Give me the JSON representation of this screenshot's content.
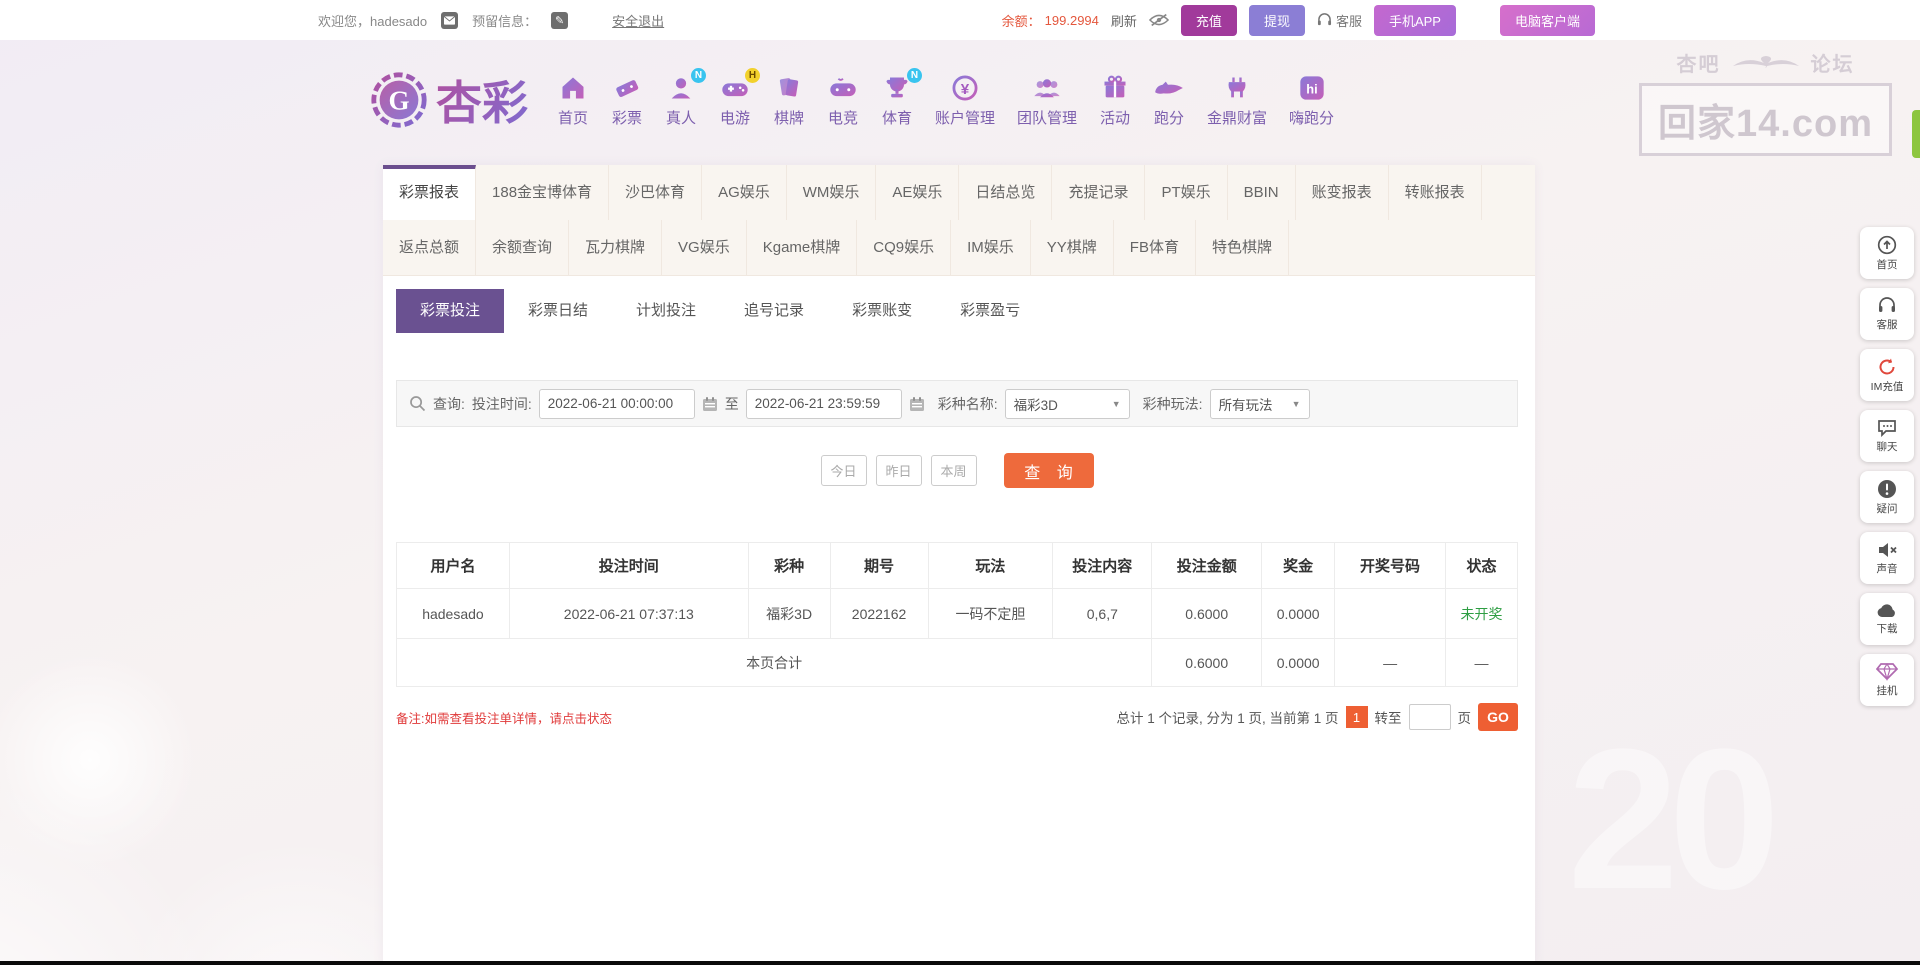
{
  "topbar": {
    "welcome": "欢迎您，hadesado",
    "reserved_label": "预留信息：",
    "logout": "安全退出",
    "balance_label": "余额：",
    "balance_value": "199.2994",
    "refresh": "刷新",
    "recharge": "充值",
    "withdraw": "提现",
    "service": "客服",
    "mobile_app": "手机APP",
    "pc_client": "电脑客户端"
  },
  "brand": {
    "name": "杏彩"
  },
  "nav": {
    "items": [
      {
        "label": "首页",
        "icon": "home-icon",
        "badge": ""
      },
      {
        "label": "彩票",
        "icon": "lottery-ticket-icon",
        "badge": ""
      },
      {
        "label": "真人",
        "icon": "live-dealer-icon",
        "badge": "N"
      },
      {
        "label": "电游",
        "icon": "slot-games-icon",
        "badge": "H"
      },
      {
        "label": "棋牌",
        "icon": "card-games-icon",
        "badge": ""
      },
      {
        "label": "电竞",
        "icon": "esports-icon",
        "badge": ""
      },
      {
        "label": "体育",
        "icon": "sports-trophy-icon",
        "badge": "N"
      },
      {
        "label": "账户管理",
        "icon": "account-coin-icon",
        "badge": ""
      },
      {
        "label": "团队管理",
        "icon": "team-icon",
        "badge": ""
      },
      {
        "label": "活动",
        "icon": "gift-icon",
        "badge": ""
      },
      {
        "label": "跑分",
        "icon": "paofen-icon",
        "badge": ""
      },
      {
        "label": "金鼎财富",
        "icon": "golden-ding-icon",
        "badge": ""
      },
      {
        "label": "嗨跑分",
        "icon": "hi-app-icon",
        "badge": ""
      }
    ]
  },
  "watermark": {
    "left": "杏吧",
    "right": "论坛",
    "domain": "回家14.com"
  },
  "tabs_row1": [
    {
      "label": "彩票报表",
      "active": true
    },
    {
      "label": "188金宝博体育"
    },
    {
      "label": "沙巴体育"
    },
    {
      "label": "AG娱乐"
    },
    {
      "label": "WM娱乐"
    },
    {
      "label": "AE娱乐"
    },
    {
      "label": "日结总览"
    },
    {
      "label": "充提记录"
    },
    {
      "label": "PT娱乐"
    },
    {
      "label": "BBIN"
    },
    {
      "label": "账变报表"
    },
    {
      "label": "转账报表"
    }
  ],
  "tabs_row2": [
    {
      "label": "返点总额"
    },
    {
      "label": "余额查询"
    },
    {
      "label": "瓦力棋牌"
    },
    {
      "label": "VG娱乐"
    },
    {
      "label": "Kgame棋牌"
    },
    {
      "label": "CQ9娱乐"
    },
    {
      "label": "IM娱乐"
    },
    {
      "label": "YY棋牌"
    },
    {
      "label": "FB体育"
    },
    {
      "label": "特色棋牌"
    }
  ],
  "subtabs": [
    {
      "label": "彩票投注",
      "active": true
    },
    {
      "label": "彩票日结"
    },
    {
      "label": "计划投注"
    },
    {
      "label": "追号记录"
    },
    {
      "label": "彩票账变"
    },
    {
      "label": "彩票盈亏"
    }
  ],
  "filter": {
    "query_label": "查询:",
    "time_label": "投注时间:",
    "time_from": "2022-06-21 00:00:00",
    "to_label": "至",
    "time_to": "2022-06-21 23:59:59",
    "lottery_label": "彩种名称:",
    "lottery_value": "福彩3D",
    "play_label": "彩种玩法:",
    "play_value": "所有玩法"
  },
  "quick": {
    "today": "今日",
    "yesterday": "昨日",
    "week": "本周",
    "query": "查 询"
  },
  "table": {
    "headers": [
      "用户名",
      "投注时间",
      "彩种",
      "期号",
      "玩法",
      "投注内容",
      "投注金额",
      "奖金",
      "开奖号码",
      "状态"
    ],
    "rows": [
      [
        "hadesado",
        "2022-06-21 07:37:13",
        "福彩3D",
        "2022162",
        "一码不定胆",
        "0,6,7",
        "0.6000",
        "0.0000",
        "",
        "未开奖"
      ]
    ],
    "total_label": "本页合计",
    "total": {
      "bet": "0.6000",
      "prize": "0.0000",
      "draw": "—",
      "status": "—"
    }
  },
  "footer": {
    "note": "备注:如需查看投注单详情，请点击状态",
    "summary": "总计 1 个记录, 分为 1 页, 当前第 1 页",
    "page": "1",
    "goto_label": "转至",
    "page_unit": "页",
    "go": "GO"
  },
  "sidebar": {
    "items": [
      {
        "label": "首页",
        "icon": "home-circle-icon"
      },
      {
        "label": "客服",
        "icon": "headset-icon"
      },
      {
        "label": "IM充值",
        "icon": "im-recharge-icon"
      },
      {
        "label": "聊天",
        "icon": "chat-bubble-icon"
      },
      {
        "label": "疑问",
        "icon": "question-icon"
      },
      {
        "label": "声音",
        "icon": "sound-mute-icon"
      },
      {
        "label": "下载",
        "icon": "download-cloud-icon"
      },
      {
        "label": "挂机",
        "icon": "hangup-gem-icon"
      }
    ]
  },
  "colors": {
    "accent_purple": "#6b4e8e",
    "subtab_purple": "#6a5191",
    "accent_orange": "#ee6a3c",
    "pager_orange": "#ee5f33",
    "balance_red": "#e4573d",
    "status_green": "#2e9e43",
    "note_red": "#e03a3a",
    "badge_blue": "#39c4ef",
    "badge_yellow": "#f2d12c"
  }
}
